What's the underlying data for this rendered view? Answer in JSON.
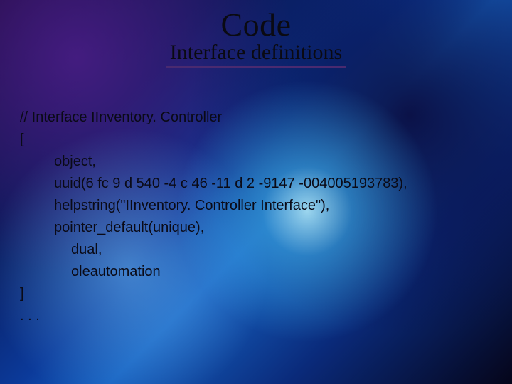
{
  "title": "Code",
  "subtitle": "Interface definitions",
  "code": {
    "comment": "// Interface IInventory. Controller",
    "open": "[",
    "lines_lvl1": [
      "object,",
      "uuid(6 fc 9 d 540 -4 c 46 -11 d 2 -9147 -004005193783),",
      "helpstring(\"IInventory. Controller Interface\"),",
      "pointer_default(unique),"
    ],
    "lines_lvl2": [
      "dual,",
      "oleautomation"
    ],
    "close": "]",
    "continuation": ". . ."
  }
}
